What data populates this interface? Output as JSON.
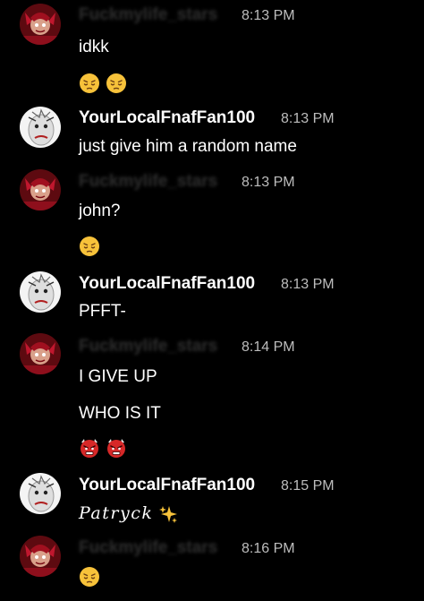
{
  "messages": [
    {
      "author": "Fuckmylife_stars",
      "time": "8:13 PM",
      "lines": [
        "idkk"
      ],
      "emojis": [
        "pensive",
        "pensive"
      ]
    },
    {
      "author": "YourLocalFnafFan100",
      "time": "8:13 PM",
      "lines": [
        "just give him a random name"
      ],
      "emojis": []
    },
    {
      "author": "Fuckmylife_stars",
      "time": "8:13 PM",
      "lines": [
        "john?"
      ],
      "emojis": [
        "pensive"
      ]
    },
    {
      "author": "YourLocalFnafFan100",
      "time": "8:13 PM",
      "lines": [
        "PFFT-"
      ],
      "emojis": []
    },
    {
      "author": "Fuckmylife_stars",
      "time": "8:14 PM",
      "lines": [
        "I GIVE UP",
        "WHO IS IT"
      ],
      "emojis": [
        "angry-devil",
        "angry-devil"
      ]
    },
    {
      "author": "YourLocalFnafFan100",
      "time": "8:15 PM",
      "lines": [
        "Patryck"
      ],
      "emojis": [
        "sparkles"
      ]
    },
    {
      "author": "Fuckmylife_stars",
      "time": "8:16 PM",
      "lines": [],
      "emojis": [
        "pensive"
      ]
    }
  ],
  "avatars": {
    "stars_user": {
      "icon": "red-character-avatar",
      "accent": "#b5122b"
    },
    "fnaf_user": {
      "icon": "white-face-avatar",
      "accent": "#e8e8e8"
    }
  }
}
